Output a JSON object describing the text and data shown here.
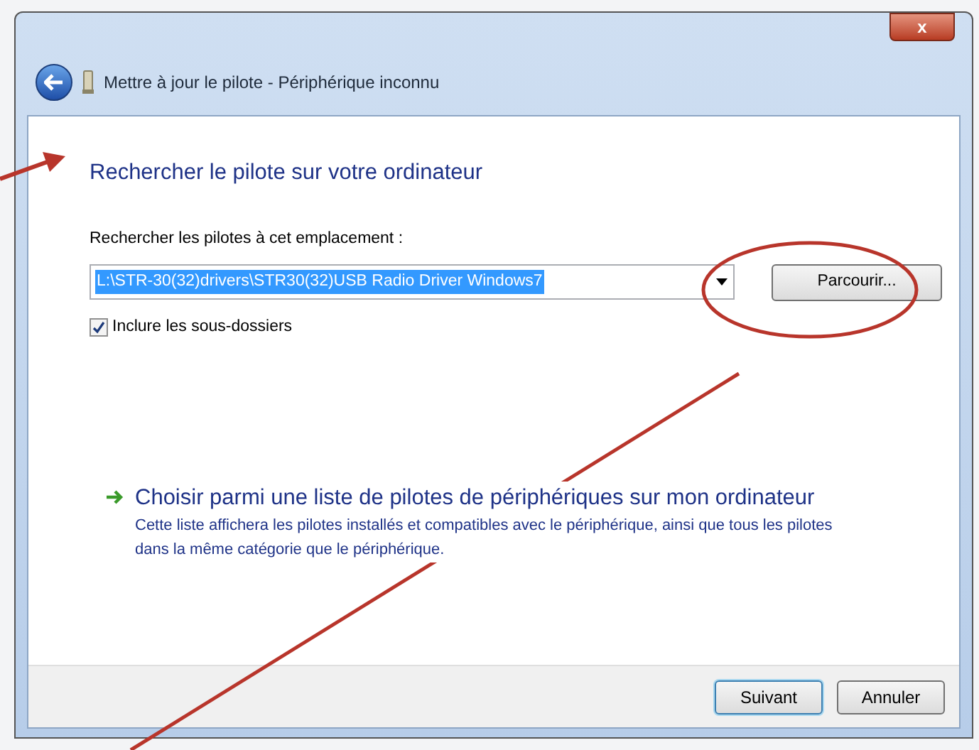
{
  "window": {
    "title": "Mettre à jour le pilote - Périphérique inconnu",
    "close": "x"
  },
  "heading": "Rechercher le pilote sur votre ordinateur",
  "location": {
    "label": "Rechercher les pilotes à cet emplacement :",
    "value": "L:\\STR-30(32)drivers\\STR30(32)USB Radio Driver Windows7",
    "selected": true
  },
  "browse_button": "Parcourir...",
  "include_subfolders": {
    "label": "Inclure les sous-dossiers",
    "checked": true
  },
  "choose_link": {
    "title": "Choisir parmi une liste de pilotes de périphériques sur mon ordinateur",
    "description": "Cette liste affichera les pilotes installés et compatibles avec le périphérique, ainsi que tous les pilotes dans la même catégorie que le périphérique."
  },
  "buttons": [
    {
      "label": "Suivant",
      "selected": true
    },
    {
      "label": "Annuler",
      "selected": false
    }
  ]
}
